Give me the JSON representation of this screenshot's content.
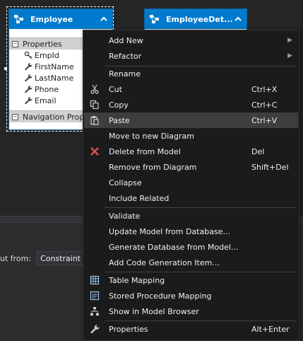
{
  "entities": {
    "employee": {
      "name": "Employee",
      "properties_label": "Properties",
      "properties": [
        "EmpId",
        "FirstName",
        "LastName",
        "Phone",
        "Email"
      ],
      "navigation_label": "Navigation Properties"
    },
    "employee_details": {
      "name": "EmployeeDet..."
    }
  },
  "lower_pane": {
    "label": "ut from:",
    "combo_value": "Constraint Validation"
  },
  "context_menu": {
    "add_new": "Add New",
    "refactor": "Refactor",
    "rename": "Rename",
    "cut": "Cut",
    "cut_shortcut": "Ctrl+X",
    "copy": "Copy",
    "copy_shortcut": "Ctrl+C",
    "paste": "Paste",
    "paste_shortcut": "Ctrl+V",
    "move_to_new_diagram": "Move to new Diagram",
    "delete_from_model": "Delete from Model",
    "delete_shortcut": "Del",
    "remove_from_diagram": "Remove from Diagram",
    "remove_shortcut": "Shift+Del",
    "collapse": "Collapse",
    "include_related": "Include Related",
    "validate": "Validate",
    "update_model": "Update Model from Database...",
    "generate_db": "Generate Database from Model...",
    "add_codegen": "Add Code Generation Item...",
    "table_mapping": "Table Mapping",
    "stored_procedure_mapping": "Stored Procedure Mapping",
    "show_in_model_browser": "Show in Model Browser",
    "properties": "Properties",
    "properties_shortcut": "Alt+Enter"
  },
  "colors": {
    "accent": "#007acc",
    "background": "#252526",
    "menu_background": "#1b1b1c",
    "menu_hover": "#3e3e40",
    "delete_icon": "#e05050"
  },
  "icons": {
    "entity": "entity-icon",
    "key": "key-icon",
    "wrench": "wrench-icon",
    "cut": "scissors-icon",
    "copy": "copy-icon",
    "paste": "paste-icon",
    "delete": "red-x-icon",
    "table_mapping": "grid-icon",
    "stored_procedure_mapping": "list-icon",
    "model_browser": "tree-icon",
    "properties": "wrench-icon"
  }
}
